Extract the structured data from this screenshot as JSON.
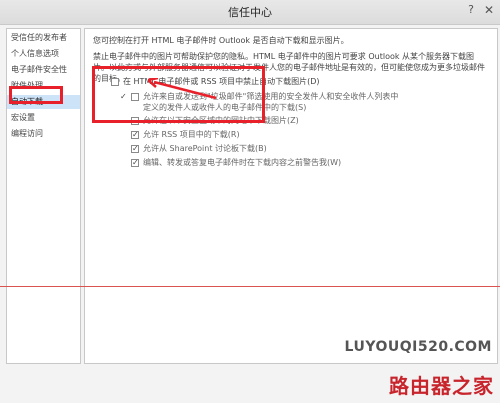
{
  "window": {
    "title": "信任中心",
    "help_glyph": "?",
    "close_glyph": "✕"
  },
  "sidebar": {
    "items": [
      {
        "label": "受信任的发布者"
      },
      {
        "label": "个人信息选项"
      },
      {
        "label": "电子邮件安全性"
      },
      {
        "label": "附件处理"
      },
      {
        "label": "自动下载",
        "active": true
      },
      {
        "label": "宏设置"
      },
      {
        "label": "编程访问"
      }
    ]
  },
  "main": {
    "intro": "您可控制在打开 HTML 电子邮件时 Outlook 是否自动下载和显示图片。",
    "desc": "禁止电子邮件中的图片可帮助保护您的隐私。HTML 电子邮件中的图片可要求 Outlook 从某个服务器下载图片。以此方式与外部服务器通信可以验证对于发件人您的电子邮件地址是有效的，但可能使您成为更多垃圾邮件的目标。",
    "options": [
      {
        "label": "在 HTML 电子邮件或 RSS 项目中禁止自动下载图片(D)",
        "checked": false
      },
      {
        "label": "允许来自或发送到\"垃圾邮件\"筛选使用的安全发件人和安全收件人列表中定义的发件人或收件人的电子邮件中的下载(S)",
        "checked": true
      },
      {
        "label": "允许在以下安全区域中的网站中下载图片(Z)",
        "checked": false
      },
      {
        "label": "允许 RSS 项目中的下载(R)",
        "checked": true
      },
      {
        "label": "允许从 SharePoint 讨论板下载(B)",
        "checked": true
      },
      {
        "label": "编辑、转发或答复电子邮件时在下载内容之前警告我(W)",
        "checked": true
      }
    ]
  },
  "watermark": {
    "site": "LUYOUQI520.COM",
    "brand": "路由器之家"
  },
  "colors": {
    "highlight_red": "#e8202a",
    "selection_blue": "#cde3f7"
  }
}
